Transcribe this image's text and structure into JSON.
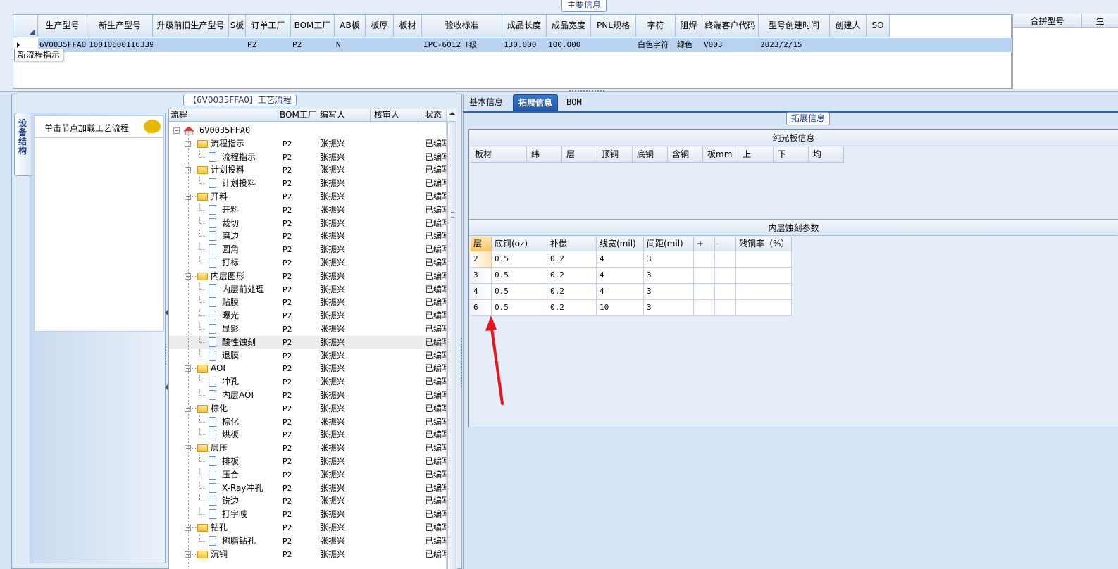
{
  "main_info": {
    "title": "主要信息",
    "columns": [
      "生产型号",
      "新生产型号",
      "升级前旧生产型号",
      "S板",
      "订单工厂",
      "BOM工厂",
      "AB板",
      "板厚",
      "板材",
      "验收标准",
      "成品长度",
      "成品宽度",
      "PNL规格",
      "字符",
      "阻焊",
      "终端客户代码",
      "型号创建时间",
      "创建人",
      "SO"
    ],
    "row": {
      "生产型号": "6V0035FFA0",
      "新生产型号": "10010600116339",
      "升级前旧生产型号": "",
      "S板": "",
      "订单工厂": "P2",
      "BOM工厂": "P2",
      "AB板": "N",
      "板厚": "",
      "板材": "",
      "验收标准": "IPC-6012 Ⅱ级",
      "成品长度": "130.000",
      "成品宽度": "100.000",
      "PNL规格": "",
      "字符": "白色字符",
      "阻焊": "绿色",
      "终端客户代码": "V003",
      "型号创建时间": "2023/2/15",
      "创建人": "",
      "SO": ""
    },
    "tooltip": "新流程指示",
    "merge_columns": [
      "合拼型号",
      "生"
    ]
  },
  "left": {
    "flow_title": "【6V0035FFA0】工艺流程",
    "side_tab": "设备结构",
    "node_header": "单击节点加载工艺流程",
    "tree_headers": [
      "流程",
      "BOM工厂",
      "编写人",
      "核审人",
      "状态"
    ],
    "tree": [
      {
        "label": "6V0035FFA0",
        "level": 0,
        "kind": "root",
        "bom": "",
        "author": "",
        "status": ""
      },
      {
        "label": "流程指示",
        "level": 1,
        "kind": "folder",
        "bom": "P2",
        "author": "张振兴",
        "status": "已编写"
      },
      {
        "label": "流程指示",
        "level": 2,
        "kind": "doc",
        "bom": "P2",
        "author": "张振兴",
        "status": "已编写"
      },
      {
        "label": "计划投料",
        "level": 1,
        "kind": "folder",
        "bom": "P2",
        "author": "张振兴",
        "status": "已编写"
      },
      {
        "label": "计划投料",
        "level": 2,
        "kind": "doc",
        "bom": "P2",
        "author": "张振兴",
        "status": "已编写"
      },
      {
        "label": "开料",
        "level": 1,
        "kind": "folder",
        "bom": "P2",
        "author": "张振兴",
        "status": "已编写"
      },
      {
        "label": "开料",
        "level": 2,
        "kind": "doc",
        "bom": "P2",
        "author": "张振兴",
        "status": "已编写"
      },
      {
        "label": "裁切",
        "level": 2,
        "kind": "doc",
        "bom": "P2",
        "author": "张振兴",
        "status": "已编写"
      },
      {
        "label": "磨边",
        "level": 2,
        "kind": "doc",
        "bom": "P2",
        "author": "张振兴",
        "status": "已编写"
      },
      {
        "label": "圆角",
        "level": 2,
        "kind": "doc",
        "bom": "P2",
        "author": "张振兴",
        "status": "已编写"
      },
      {
        "label": "打标",
        "level": 2,
        "kind": "doc",
        "bom": "P2",
        "author": "张振兴",
        "status": "已编写"
      },
      {
        "label": "内层图形",
        "level": 1,
        "kind": "folder",
        "bom": "P2",
        "author": "张振兴",
        "status": "已编写"
      },
      {
        "label": "内层前处理",
        "level": 2,
        "kind": "doc",
        "bom": "P2",
        "author": "张振兴",
        "status": "已编写"
      },
      {
        "label": "贴膜",
        "level": 2,
        "kind": "doc",
        "bom": "P2",
        "author": "张振兴",
        "status": "已编写"
      },
      {
        "label": "曝光",
        "level": 2,
        "kind": "doc",
        "bom": "P2",
        "author": "张振兴",
        "status": "已编写"
      },
      {
        "label": "显影",
        "level": 2,
        "kind": "doc",
        "bom": "P2",
        "author": "张振兴",
        "status": "已编写"
      },
      {
        "label": "酸性蚀刻",
        "level": 2,
        "kind": "doc",
        "bom": "P2",
        "author": "张振兴",
        "status": "已编写",
        "selected": true
      },
      {
        "label": "退膜",
        "level": 2,
        "kind": "doc",
        "bom": "P2",
        "author": "张振兴",
        "status": "已编写"
      },
      {
        "label": "AOI",
        "level": 1,
        "kind": "folder",
        "bom": "P2",
        "author": "张振兴",
        "status": "已编写"
      },
      {
        "label": "冲孔",
        "level": 2,
        "kind": "doc",
        "bom": "P2",
        "author": "张振兴",
        "status": "已编写"
      },
      {
        "label": "内层AOI",
        "level": 2,
        "kind": "doc",
        "bom": "P2",
        "author": "张振兴",
        "status": "已编写"
      },
      {
        "label": "棕化",
        "level": 1,
        "kind": "folder",
        "bom": "P2",
        "author": "张振兴",
        "status": "已编写"
      },
      {
        "label": "棕化",
        "level": 2,
        "kind": "doc",
        "bom": "P2",
        "author": "张振兴",
        "status": "已编写"
      },
      {
        "label": "烘板",
        "level": 2,
        "kind": "doc",
        "bom": "P2",
        "author": "张振兴",
        "status": "已编写"
      },
      {
        "label": "层压",
        "level": 1,
        "kind": "folder",
        "bom": "P2",
        "author": "张振兴",
        "status": "已编写"
      },
      {
        "label": "排板",
        "level": 2,
        "kind": "doc",
        "bom": "P2",
        "author": "张振兴",
        "status": "已编写"
      },
      {
        "label": "压合",
        "level": 2,
        "kind": "doc",
        "bom": "P2",
        "author": "张振兴",
        "status": "已编写"
      },
      {
        "label": "X-Ray冲孔",
        "level": 2,
        "kind": "doc",
        "bom": "P2",
        "author": "张振兴",
        "status": "已编写"
      },
      {
        "label": "铣边",
        "level": 2,
        "kind": "doc",
        "bom": "P2",
        "author": "张振兴",
        "status": "已编写"
      },
      {
        "label": "打字唛",
        "level": 2,
        "kind": "doc",
        "bom": "P2",
        "author": "张振兴",
        "status": "已编写"
      },
      {
        "label": "钻孔",
        "level": 1,
        "kind": "folder",
        "bom": "P2",
        "author": "张振兴",
        "status": "已编写"
      },
      {
        "label": "树脂钻孔",
        "level": 2,
        "kind": "doc",
        "bom": "P2",
        "author": "张振兴",
        "status": "已编写"
      },
      {
        "label": "沉铜",
        "level": 1,
        "kind": "folder",
        "bom": "P2",
        "author": "张振兴",
        "status": "已编写"
      }
    ]
  },
  "right": {
    "tabs": [
      "基本信息",
      "拓展信息",
      "BOM"
    ],
    "ext_title": "拓展信息",
    "bare_board": {
      "title": "纯光板信息",
      "columns": [
        "板材",
        "纬",
        "层",
        "顶铜",
        "底铜",
        "含铜",
        "板mm",
        "上",
        "下",
        "均"
      ]
    },
    "etch": {
      "title": "内层蚀刻参数",
      "columns": [
        "层",
        "底铜(oz)",
        "补偿",
        "线宽(mil)",
        "间距(mil)",
        "+",
        "-",
        "残铜率（%）"
      ],
      "rows": [
        [
          "2",
          "0.5",
          "0.2",
          "4",
          "3",
          "",
          "",
          ""
        ],
        [
          "3",
          "0.5",
          "0.2",
          "4",
          "3",
          "",
          "",
          ""
        ],
        [
          "4",
          "0.5",
          "0.2",
          "4",
          "3",
          "",
          "",
          ""
        ],
        [
          "6",
          "0.5",
          "0.2",
          "10",
          "3",
          "",
          "",
          ""
        ]
      ]
    },
    "annotation_color": "#e8141c"
  }
}
